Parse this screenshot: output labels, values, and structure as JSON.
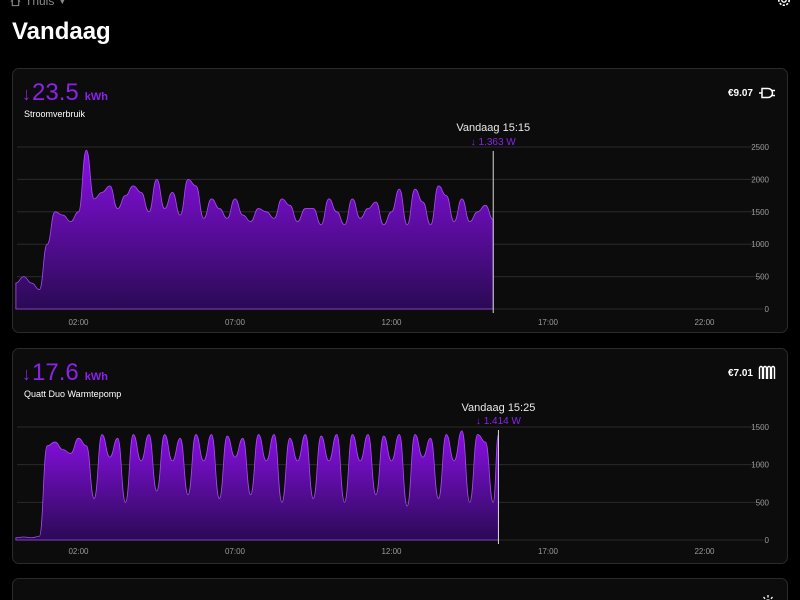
{
  "header": {
    "home_label": "Thuis",
    "title": "Vandaag"
  },
  "colors": {
    "accent": "#8b22e8",
    "fill_top": "#8a0fe6",
    "fill_bottom": "#2a0a55",
    "grid": "#2a2a2c",
    "background": "#000000"
  },
  "cards": [
    {
      "arrow": "↓",
      "value": "23.5",
      "unit": "kWh",
      "name": "Stroomverbruik",
      "cost": "€9.07",
      "icon": "plug-icon",
      "tooltip_time": "Vandaag 15:15",
      "tooltip_value": "↓ 1.363 W",
      "chart_data": {
        "type": "area",
        "x_ticks": [
          "02:00",
          "07:00",
          "12:00",
          "17:00",
          "22:00"
        ],
        "y_ticks": [
          "0",
          "500",
          "1000",
          "1500",
          "2000",
          "2500"
        ],
        "ylim": [
          0,
          2500
        ],
        "x": [
          "00:00",
          "00:15",
          "00:30",
          "00:45",
          "01:00",
          "01:15",
          "01:30",
          "01:45",
          "02:00",
          "02:15",
          "02:30",
          "02:45",
          "03:00",
          "03:15",
          "03:30",
          "03:45",
          "04:00",
          "04:15",
          "04:30",
          "04:45",
          "05:00",
          "05:15",
          "05:30",
          "05:45",
          "06:00",
          "06:15",
          "06:30",
          "06:45",
          "07:00",
          "07:15",
          "07:30",
          "07:45",
          "08:00",
          "08:15",
          "08:30",
          "08:45",
          "09:00",
          "09:15",
          "09:30",
          "09:45",
          "10:00",
          "10:15",
          "10:30",
          "10:45",
          "11:00",
          "11:15",
          "11:30",
          "11:45",
          "12:00",
          "12:15",
          "12:30",
          "12:45",
          "13:00",
          "13:15",
          "13:30",
          "13:45",
          "14:00",
          "14:15",
          "14:30",
          "14:45",
          "15:00",
          "15:15"
        ],
        "values": [
          400,
          500,
          400,
          300,
          1000,
          1500,
          1450,
          1350,
          1500,
          2450,
          1700,
          1800,
          1900,
          1550,
          1750,
          1900,
          1800,
          1500,
          2000,
          1550,
          1800,
          1450,
          2000,
          1900,
          1400,
          1700,
          1550,
          1400,
          1700,
          1450,
          1350,
          1550,
          1500,
          1400,
          1700,
          1600,
          1350,
          1550,
          1550,
          1300,
          1700,
          1500,
          1300,
          1700,
          1400,
          1550,
          1650,
          1300,
          1500,
          1850,
          1300,
          1850,
          1650,
          1300,
          1900,
          1750,
          1350,
          1700,
          1350,
          1500,
          1600,
          1380
        ]
      }
    },
    {
      "arrow": "↓",
      "value": "17.6",
      "unit": "kWh",
      "name": "Quatt Duo Warmtepomp",
      "cost": "€7.01",
      "icon": "radiator-icon",
      "tooltip_time": "Vandaag 15:25",
      "tooltip_value": "↓ 1.414 W",
      "chart_data": {
        "type": "area",
        "x_ticks": [
          "02:00",
          "07:00",
          "12:00",
          "17:00",
          "22:00"
        ],
        "y_ticks": [
          "0",
          "500",
          "1000",
          "1500"
        ],
        "ylim": [
          0,
          1500
        ],
        "x": [
          "00:00",
          "00:15",
          "00:30",
          "00:45",
          "01:00",
          "01:15",
          "01:30",
          "01:45",
          "02:00",
          "02:15",
          "02:30",
          "02:45",
          "03:00",
          "03:15",
          "03:30",
          "03:45",
          "04:00",
          "04:15",
          "04:30",
          "04:45",
          "05:00",
          "05:15",
          "05:30",
          "05:45",
          "06:00",
          "06:15",
          "06:30",
          "06:45",
          "07:00",
          "07:15",
          "07:30",
          "07:45",
          "08:00",
          "08:15",
          "08:30",
          "08:45",
          "09:00",
          "09:15",
          "09:30",
          "09:45",
          "10:00",
          "10:15",
          "10:30",
          "10:45",
          "11:00",
          "11:15",
          "11:30",
          "11:45",
          "12:00",
          "12:15",
          "12:30",
          "12:45",
          "13:00",
          "13:15",
          "13:30",
          "13:45",
          "14:00",
          "14:15",
          "14:30",
          "14:45",
          "15:00",
          "15:15",
          "15:25"
        ],
        "values": [
          30,
          40,
          30,
          50,
          1250,
          1300,
          1200,
          1150,
          1350,
          1250,
          550,
          1400,
          1100,
          1350,
          500,
          1400,
          1050,
          1400,
          650,
          1400,
          1050,
          1350,
          600,
          1400,
          1050,
          1400,
          550,
          1380,
          1100,
          1350,
          600,
          1400,
          1050,
          1400,
          500,
          1350,
          1050,
          1400,
          550,
          1380,
          1050,
          1400,
          500,
          1400,
          1050,
          1400,
          600,
          1380,
          1050,
          1400,
          450,
          1400,
          1100,
          1350,
          550,
          1400,
          1050,
          1450,
          500,
          1400,
          1300,
          500,
          1400
        ]
      }
    }
  ]
}
